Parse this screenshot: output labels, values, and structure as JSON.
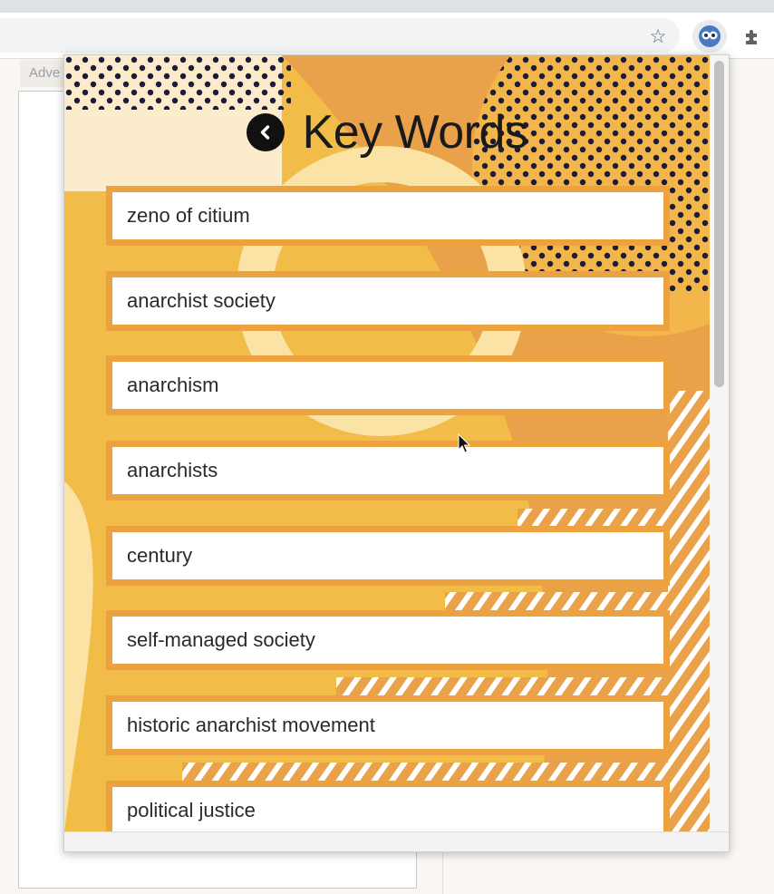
{
  "browser": {
    "ad_label": "Adve",
    "icons": [
      "star-icon",
      "extension-active-icon",
      "puzzle-icon"
    ]
  },
  "popup": {
    "title": "Key Words",
    "back_icon": "chevron-left-circle-icon",
    "keywords": [
      "zeno of citium",
      "anarchist society",
      "anarchism",
      "anarchists",
      "century",
      "self-managed society",
      "historic anarchist movement",
      "political justice"
    ]
  },
  "colors": {
    "accent_orange": "#eca23f",
    "pale_yellow": "#fbe3a6",
    "mustard": "#f2bc48",
    "cream": "#fdeccb",
    "dark": "#1a1a1a"
  }
}
